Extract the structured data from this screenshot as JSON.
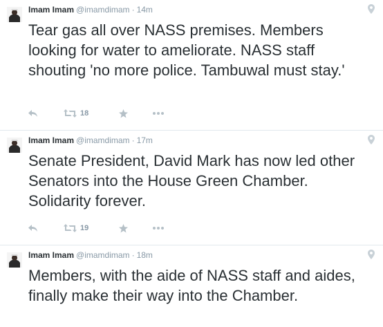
{
  "tweets": [
    {
      "name": "Imam Imam",
      "handle": "@imamdimam",
      "separator": "·",
      "time": "14m",
      "text": "Tear gas all over NASS premises. Members looking for water to ameliorate. NASS staff shouting 'no more police. Tambuwal must stay.'",
      "retweet_count": "18"
    },
    {
      "name": "Imam Imam",
      "handle": "@imamdimam",
      "separator": "·",
      "time": "17m",
      "text": "Senate President,  David Mark has now led other Senators into the House Green Chamber. Solidarity forever.",
      "retweet_count": "19"
    },
    {
      "name": "Imam Imam",
      "handle": "@imamdimam",
      "separator": "·",
      "time": "18m",
      "text": "Members,  with the aide of NASS staff and aides,  finally make their way into the Chamber."
    }
  ],
  "icons": {
    "reply": "reply-icon",
    "retweet": "retweet-icon",
    "favorite": "star-icon",
    "more": "more-icon",
    "location": "location-pin-icon"
  },
  "colors": {
    "text": "#292f33",
    "muted": "#8899a6",
    "icon": "#b5c0c7",
    "divider": "#e1e8ed"
  }
}
